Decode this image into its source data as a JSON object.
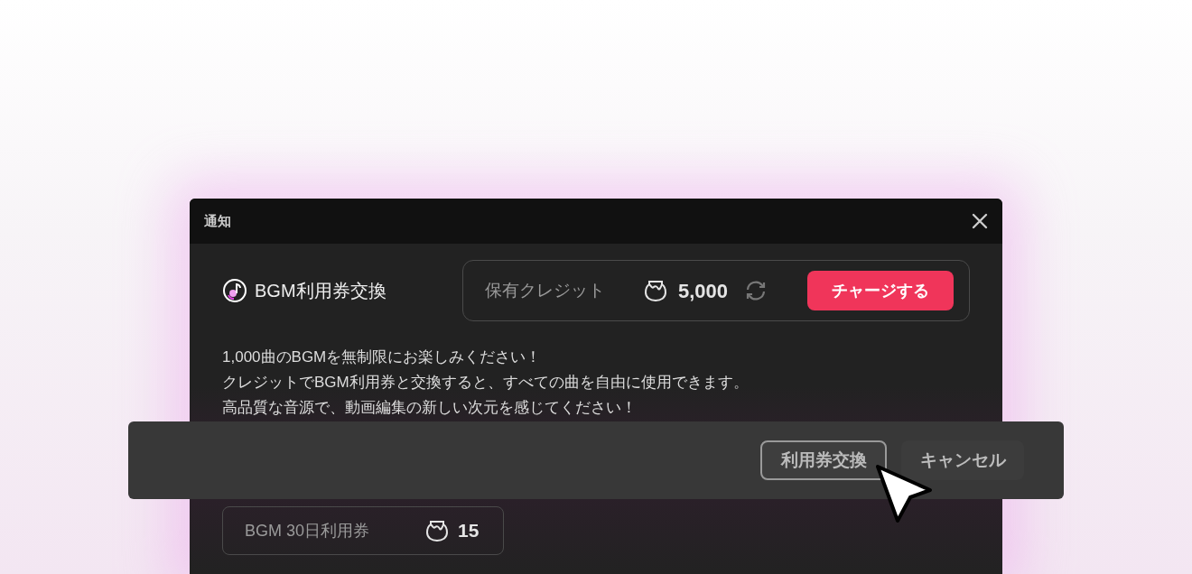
{
  "dialog": {
    "title": "通知",
    "product": "BGM利用券交換",
    "credits": {
      "label": "保有クレジット",
      "amount": "5,000"
    },
    "charge_button": "チャージする",
    "description": [
      "1,000曲のBGMを無制限にお楽しみください！",
      "クレジットでBGM利用券と交換すると、すべての曲を自由に使用できます。",
      "高品質な音源で、動画編集の新しい次元を感じてください！"
    ]
  },
  "action_bar": {
    "buttons": [
      {
        "label": "利用券交換",
        "kind": "outline"
      },
      {
        "label": "キャンセル",
        "kind": "plain"
      }
    ]
  },
  "ticket": {
    "name": "BGM 30日利用券",
    "price": "15"
  }
}
